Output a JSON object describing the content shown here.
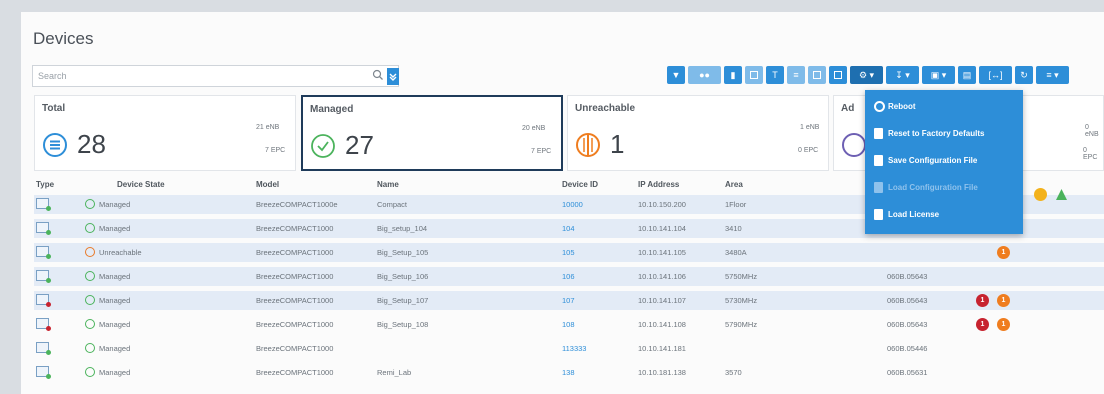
{
  "page": {
    "title": "Devices"
  },
  "search": {
    "placeholder": "Search"
  },
  "toolbar": {
    "buttons": [
      "filter-icon",
      "users-icon",
      "chart-icon",
      "grid-icon",
      "text-icon",
      "list-icon",
      "table-icon",
      "clone-icon",
      "gear-icon",
      "download-icon",
      "lock-icon",
      "columns-icon",
      "expand-icon",
      "refresh-icon",
      "menu-icon"
    ]
  },
  "cards": [
    {
      "label": "Total",
      "value": "28",
      "s1": "21 eNB",
      "s2": "7 EPC"
    },
    {
      "label": "Managed",
      "value": "27",
      "s1": "20 eNB",
      "s2": "7 EPC"
    },
    {
      "label": "Unreachable",
      "value": "1",
      "s1": "1 eNB",
      "s2": "0 EPC"
    },
    {
      "label": "Ad",
      "value": "",
      "s1": "0 eNB",
      "s2": "0 EPC"
    }
  ],
  "columns": [
    "Type",
    "Device State",
    "Model",
    "Name",
    "Device ID",
    "IP Address",
    "Area"
  ],
  "rows": [
    {
      "state": "Managed",
      "model": "BreezeCOMPACT1000e",
      "name": "Compact",
      "id": "10000",
      "ip": "10.10.150.200",
      "area": "1Floor",
      "extra": "",
      "badges": []
    },
    {
      "state": "Managed",
      "model": "BreezeCOMPACT1000",
      "name": "Big_setup_104",
      "id": "104",
      "ip": "10.10.141.104",
      "area": "3410",
      "extra": "",
      "badges": []
    },
    {
      "state": "Unreachable",
      "model": "BreezeCOMPACT1000",
      "name": "Big_Setup_105",
      "id": "105",
      "ip": "10.10.141.105",
      "area": "3480A",
      "extra": "",
      "badges": [
        "org"
      ]
    },
    {
      "state": "Managed",
      "model": "BreezeCOMPACT1000",
      "name": "Big_Setup_106",
      "id": "106",
      "ip": "10.10.141.106",
      "area": "5750MHz",
      "extra": "060B.05643",
      "badges": []
    },
    {
      "state": "Managed",
      "model": "BreezeCOMPACT1000",
      "name": "Big_Setup_107",
      "id": "107",
      "ip": "10.10.141.107",
      "area": "5730MHz",
      "extra": "060B.05643",
      "badges": [
        "red",
        "org"
      ]
    },
    {
      "state": "Managed",
      "model": "BreezeCOMPACT1000",
      "name": "Big_Setup_108",
      "id": "108",
      "ip": "10.10.141.108",
      "area": "5790MHz",
      "extra": "060B.05643",
      "badges": [
        "red",
        "org"
      ]
    },
    {
      "state": "Managed",
      "model": "BreezeCOMPACT1000",
      "name": "",
      "id": "113333",
      "ip": "10.10.141.181",
      "area": "",
      "extra": "060B.05446",
      "badges": []
    },
    {
      "state": "Managed",
      "model": "BreezeCOMPACT1000",
      "name": "Remi_Lab",
      "id": "138",
      "ip": "10.10.181.138",
      "area": "3570",
      "extra": "060B.05631",
      "badges": []
    }
  ],
  "menu": {
    "items": [
      {
        "label": "Reboot",
        "disabled": false
      },
      {
        "label": "Reset to Factory Defaults",
        "disabled": false
      },
      {
        "label": "Save Configuration File",
        "disabled": false
      },
      {
        "label": "Load Configuration File",
        "disabled": true
      },
      {
        "label": "Load License",
        "disabled": false
      }
    ]
  },
  "colors": {
    "accent": "#2d8ed8",
    "selected_border": "#1f3b5a",
    "ok": "#4bb35c",
    "warn": "#ef7d1f",
    "error": "#c7232f",
    "highlight_row": "#e3ebf6"
  }
}
